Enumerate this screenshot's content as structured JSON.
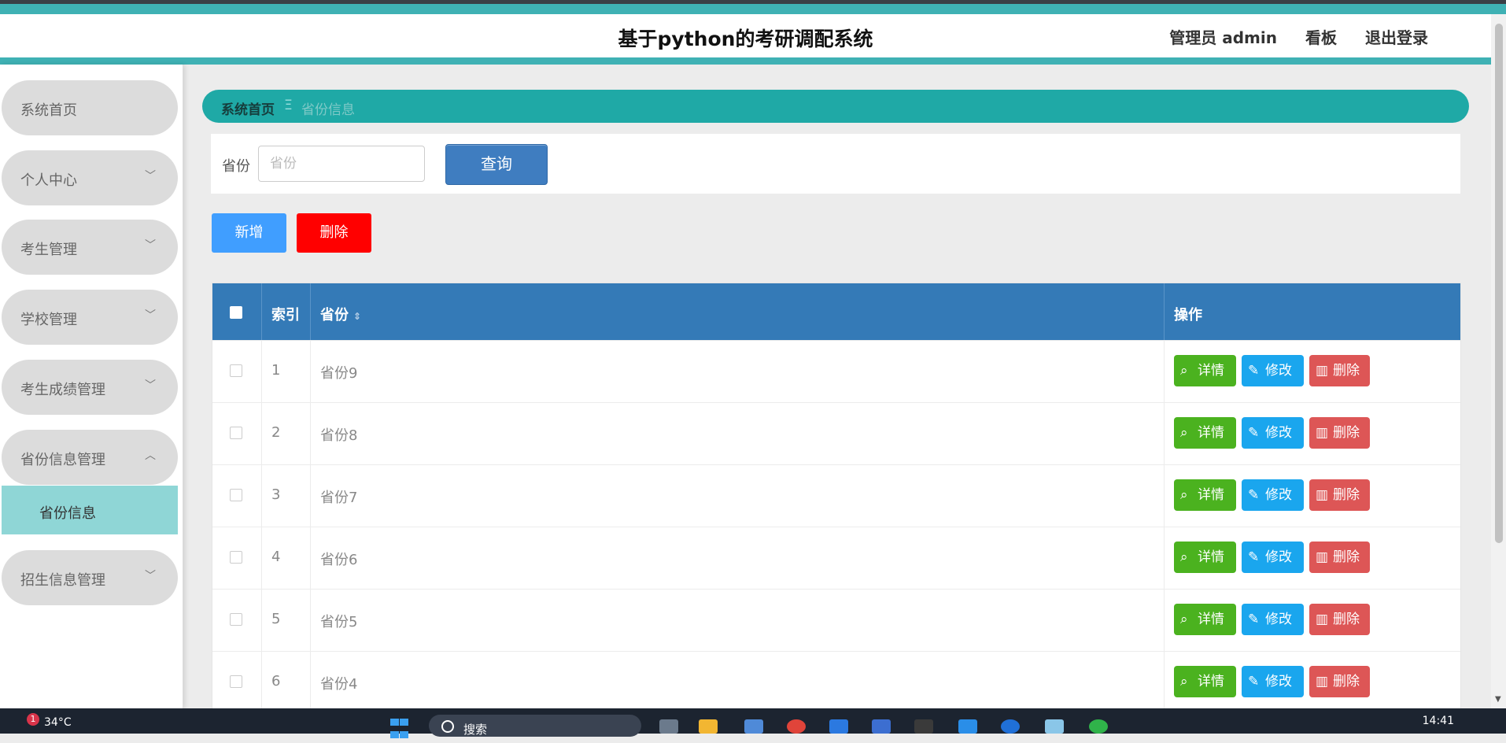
{
  "header": {
    "title": "基于python的考研调配系统",
    "links": [
      "管理员 admin",
      "看板",
      "退出登录"
    ]
  },
  "sidebar": {
    "items": [
      {
        "label": "系统首页",
        "chevron": ""
      },
      {
        "label": "个人中心",
        "chevron": "﹀"
      },
      {
        "label": "考生管理",
        "chevron": "﹀"
      },
      {
        "label": "学校管理",
        "chevron": "﹀"
      },
      {
        "label": "考生成绩管理",
        "chevron": "﹀"
      },
      {
        "label": "省份信息管理",
        "chevron": "︿"
      },
      {
        "label": "招生信息管理",
        "chevron": "﹀"
      }
    ],
    "active_sub": "省份信息"
  },
  "breadcrumb": {
    "home": "系统首页",
    "sep": "Ξ",
    "current": "省份信息"
  },
  "search": {
    "label": "省份",
    "placeholder": "省份",
    "button": "查询"
  },
  "actions": {
    "add": "新增",
    "delete": "删除"
  },
  "table": {
    "headers": {
      "index": "索引",
      "province": "省份",
      "ops": "操作"
    },
    "op_labels": {
      "detail": "详情",
      "edit": "修改",
      "delete": "删除"
    },
    "rows": [
      {
        "index": "1",
        "province": "省份9"
      },
      {
        "index": "2",
        "province": "省份8"
      },
      {
        "index": "3",
        "province": "省份7"
      },
      {
        "index": "4",
        "province": "省份6"
      },
      {
        "index": "5",
        "province": "省份5"
      },
      {
        "index": "6",
        "province": "省份4"
      }
    ]
  },
  "taskbar": {
    "weather": "34°C",
    "badge": "1",
    "search": "搜索",
    "time": "14:41"
  },
  "colors": {
    "accent": "#3fb1b4",
    "table_header": "#347ab7",
    "detail": "#4bb21f",
    "edit": "#1aa6ee",
    "delete": "#dd5656"
  }
}
